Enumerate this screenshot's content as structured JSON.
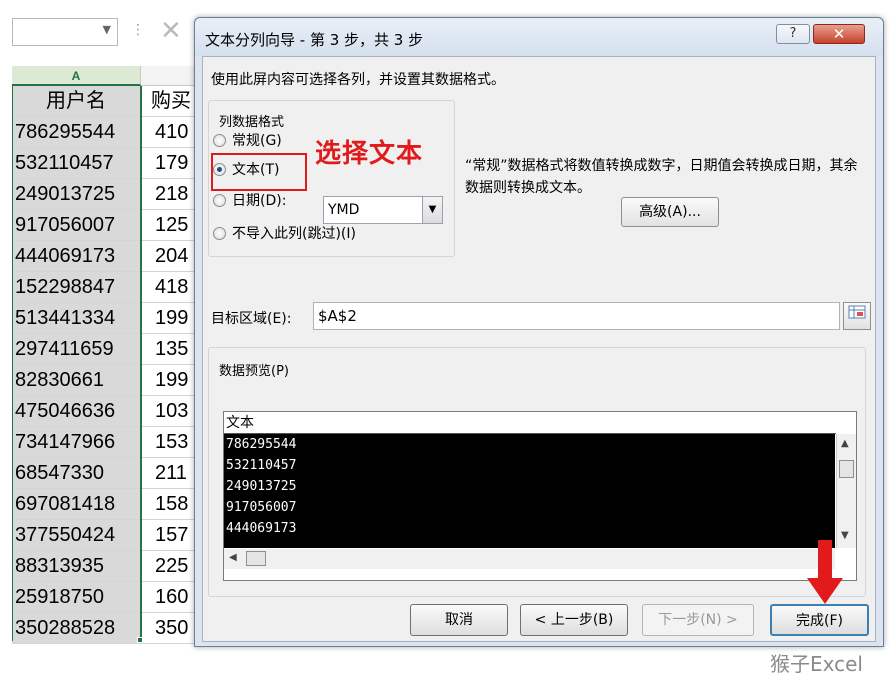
{
  "excel": {
    "header_row": {
      "col_a": "用户名",
      "col_b": "购买"
    },
    "column_a_letter": "A",
    "rows": [
      {
        "a": "786295544",
        "b": "410"
      },
      {
        "a": "532110457",
        "b": "179"
      },
      {
        "a": "249013725",
        "b": "218"
      },
      {
        "a": "917056007",
        "b": "125"
      },
      {
        "a": "444069173",
        "b": "204"
      },
      {
        "a": "152298847",
        "b": "418"
      },
      {
        "a": "513441334",
        "b": "199"
      },
      {
        "a": "297411659",
        "b": "135"
      },
      {
        "a": "82830661",
        "b": "199"
      },
      {
        "a": "475046636",
        "b": "103"
      },
      {
        "a": "734147966",
        "b": "153"
      },
      {
        "a": "68547330",
        "b": "211"
      },
      {
        "a": "697081418",
        "b": "158"
      },
      {
        "a": "377550424",
        "b": "157"
      },
      {
        "a": "88313935",
        "b": "225"
      },
      {
        "a": "25918750",
        "b": "160"
      },
      {
        "a": "350288528",
        "b": "350"
      }
    ]
  },
  "dialog": {
    "title": "文本分列向导 - 第 3 步，共 3 步",
    "help_label": "?",
    "close_label": "✕",
    "instruction": "使用此屏内容可选择各列，并设置其数据格式。",
    "format_group_label": "列数据格式",
    "options": {
      "general": "常规(G)",
      "text": "文本(T)",
      "date": "日期(D):",
      "skip": "不导入此列(跳过)(I)"
    },
    "selected_option": "text",
    "date_format": "YMD",
    "annotation": "选择文本",
    "format_description": "“常规”数据格式将数值转换成数字，日期值会转换成日期，其余数据则转换成文本。",
    "advanced_button": "高级(A)...",
    "destination_label": "目标区域(E):",
    "destination_value": "$A$2",
    "preview_label": "数据预览(P)",
    "preview_header": "文本",
    "preview_rows": [
      "786295544",
      "532110457",
      "249013725",
      "917056007",
      "444069173"
    ],
    "buttons": {
      "cancel": "取消",
      "back": "< 上一步(B)",
      "next": "下一步(N) >",
      "finish": "完成(F)"
    }
  },
  "watermark": "猴子Excel",
  "colors": {
    "annotation_red": "#e11b1b",
    "excel_green": "#217346",
    "dialog_frame": "#dbe4ef"
  }
}
